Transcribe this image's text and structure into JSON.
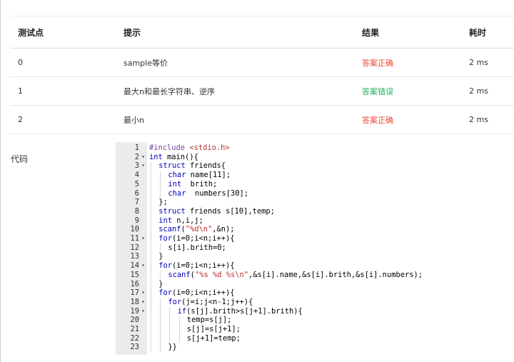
{
  "table": {
    "headers": [
      "测试点",
      "提示",
      "结果",
      "耗时"
    ],
    "rows": [
      {
        "point": "0",
        "hint": "sample等价",
        "result": "答案正确",
        "time": "2 ms"
      },
      {
        "point": "1",
        "hint": "最大n和最长字符串、逆序",
        "result": "答案错误",
        "time": "2 ms"
      },
      {
        "point": "2",
        "hint": "最小n",
        "result": "答案正确",
        "time": "2 ms"
      }
    ]
  },
  "code_label": "代码",
  "colors": {
    "correct": "#e74c3c",
    "wrong": "#27ae60",
    "keyword": "#0000c0",
    "string": "#b8312f",
    "gutter": "#ebebeb"
  },
  "code": {
    "lines": [
      {
        "n": "1",
        "fold": false,
        "indent": 0,
        "text": "#include <stdio.h>"
      },
      {
        "n": "2",
        "fold": true,
        "indent": 0,
        "text": "int main(){"
      },
      {
        "n": "3",
        "fold": true,
        "indent": 1,
        "text": "struct friends{"
      },
      {
        "n": "4",
        "fold": false,
        "indent": 2,
        "text": "char name[11];"
      },
      {
        "n": "5",
        "fold": false,
        "indent": 2,
        "text": "int  brith;"
      },
      {
        "n": "6",
        "fold": false,
        "indent": 2,
        "text": "char  numbers[30];"
      },
      {
        "n": "7",
        "fold": false,
        "indent": 1,
        "text": "};"
      },
      {
        "n": "8",
        "fold": false,
        "indent": 1,
        "text": "struct friends s[10],temp;"
      },
      {
        "n": "9",
        "fold": false,
        "indent": 1,
        "text": "int n,i,j;"
      },
      {
        "n": "10",
        "fold": false,
        "indent": 1,
        "text": "scanf(\"%d\\n\",&n);"
      },
      {
        "n": "11",
        "fold": true,
        "indent": 1,
        "text": "for(i=0;i<n;i++){"
      },
      {
        "n": "12",
        "fold": false,
        "indent": 2,
        "text": "s[i].brith=0;"
      },
      {
        "n": "13",
        "fold": false,
        "indent": 1,
        "text": "}"
      },
      {
        "n": "14",
        "fold": true,
        "indent": 1,
        "text": "for(i=0;i<n;i++){"
      },
      {
        "n": "15",
        "fold": false,
        "indent": 2,
        "text": "scanf(\"%s %d %s\\n\",&s[i].name,&s[i].brith,&s[i].numbers);"
      },
      {
        "n": "16",
        "fold": false,
        "indent": 1,
        "text": "}"
      },
      {
        "n": "17",
        "fold": true,
        "indent": 1,
        "text": "for(i=0;i<n;i++){"
      },
      {
        "n": "18",
        "fold": true,
        "indent": 2,
        "text": "for(j=i;j<n-1;j++){"
      },
      {
        "n": "19",
        "fold": true,
        "indent": 3,
        "text": "if(s[j].brith>s[j+1].brith){"
      },
      {
        "n": "20",
        "fold": false,
        "indent": 4,
        "text": "temp=s[j];"
      },
      {
        "n": "21",
        "fold": false,
        "indent": 4,
        "text": "s[j]=s[j+1];"
      },
      {
        "n": "22",
        "fold": false,
        "indent": 4,
        "text": "s[j+1]=temp;"
      },
      {
        "n": "23",
        "fold": false,
        "indent": 2,
        "text": "}}"
      }
    ]
  }
}
